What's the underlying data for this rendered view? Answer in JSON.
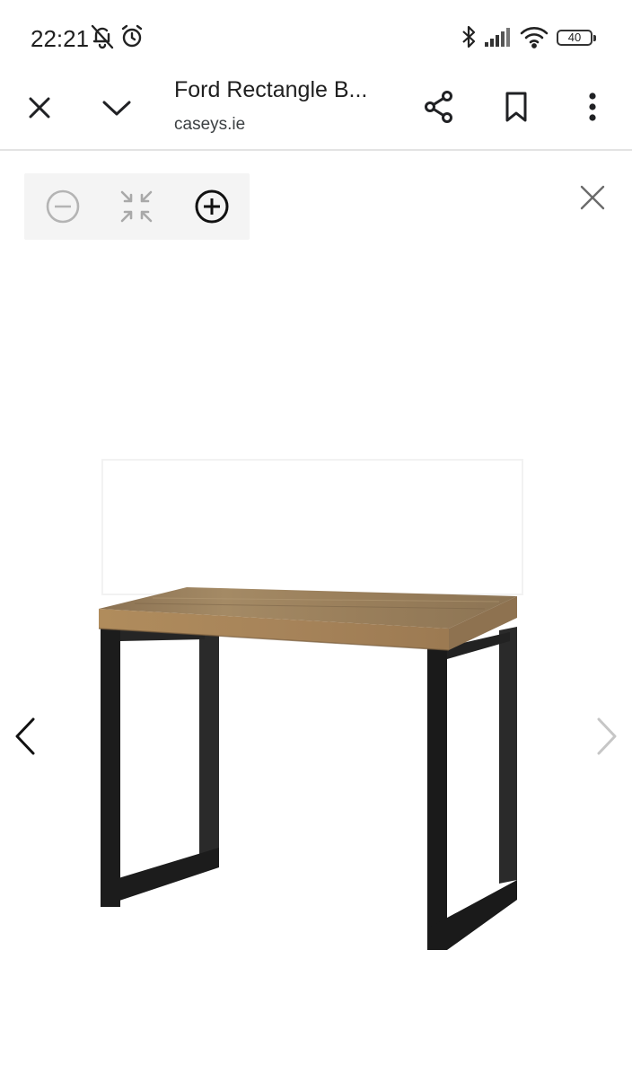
{
  "status_bar": {
    "time": "22:21",
    "battery_level": "40",
    "icons": [
      "bell-off-icon",
      "alarm-icon",
      "bluetooth-icon",
      "cell-signal-icon",
      "wifi-icon",
      "battery-icon"
    ]
  },
  "app_bar": {
    "title": "Ford Rectangle B...",
    "domain": "caseys.ie",
    "icons": [
      "close-icon",
      "chevron-down-icon",
      "share-icon",
      "bookmark-icon",
      "more-vert-icon"
    ]
  },
  "viewer": {
    "zoom_controls": [
      "zoom-out-icon",
      "fit-screen-icon",
      "zoom-in-icon"
    ],
    "image_subject": "rectangular table with wooden top and black metal legs",
    "colors": {
      "tabletop": "#a88a5e",
      "legs": "#1b1b1b",
      "panel": "#f4f4f4"
    }
  }
}
